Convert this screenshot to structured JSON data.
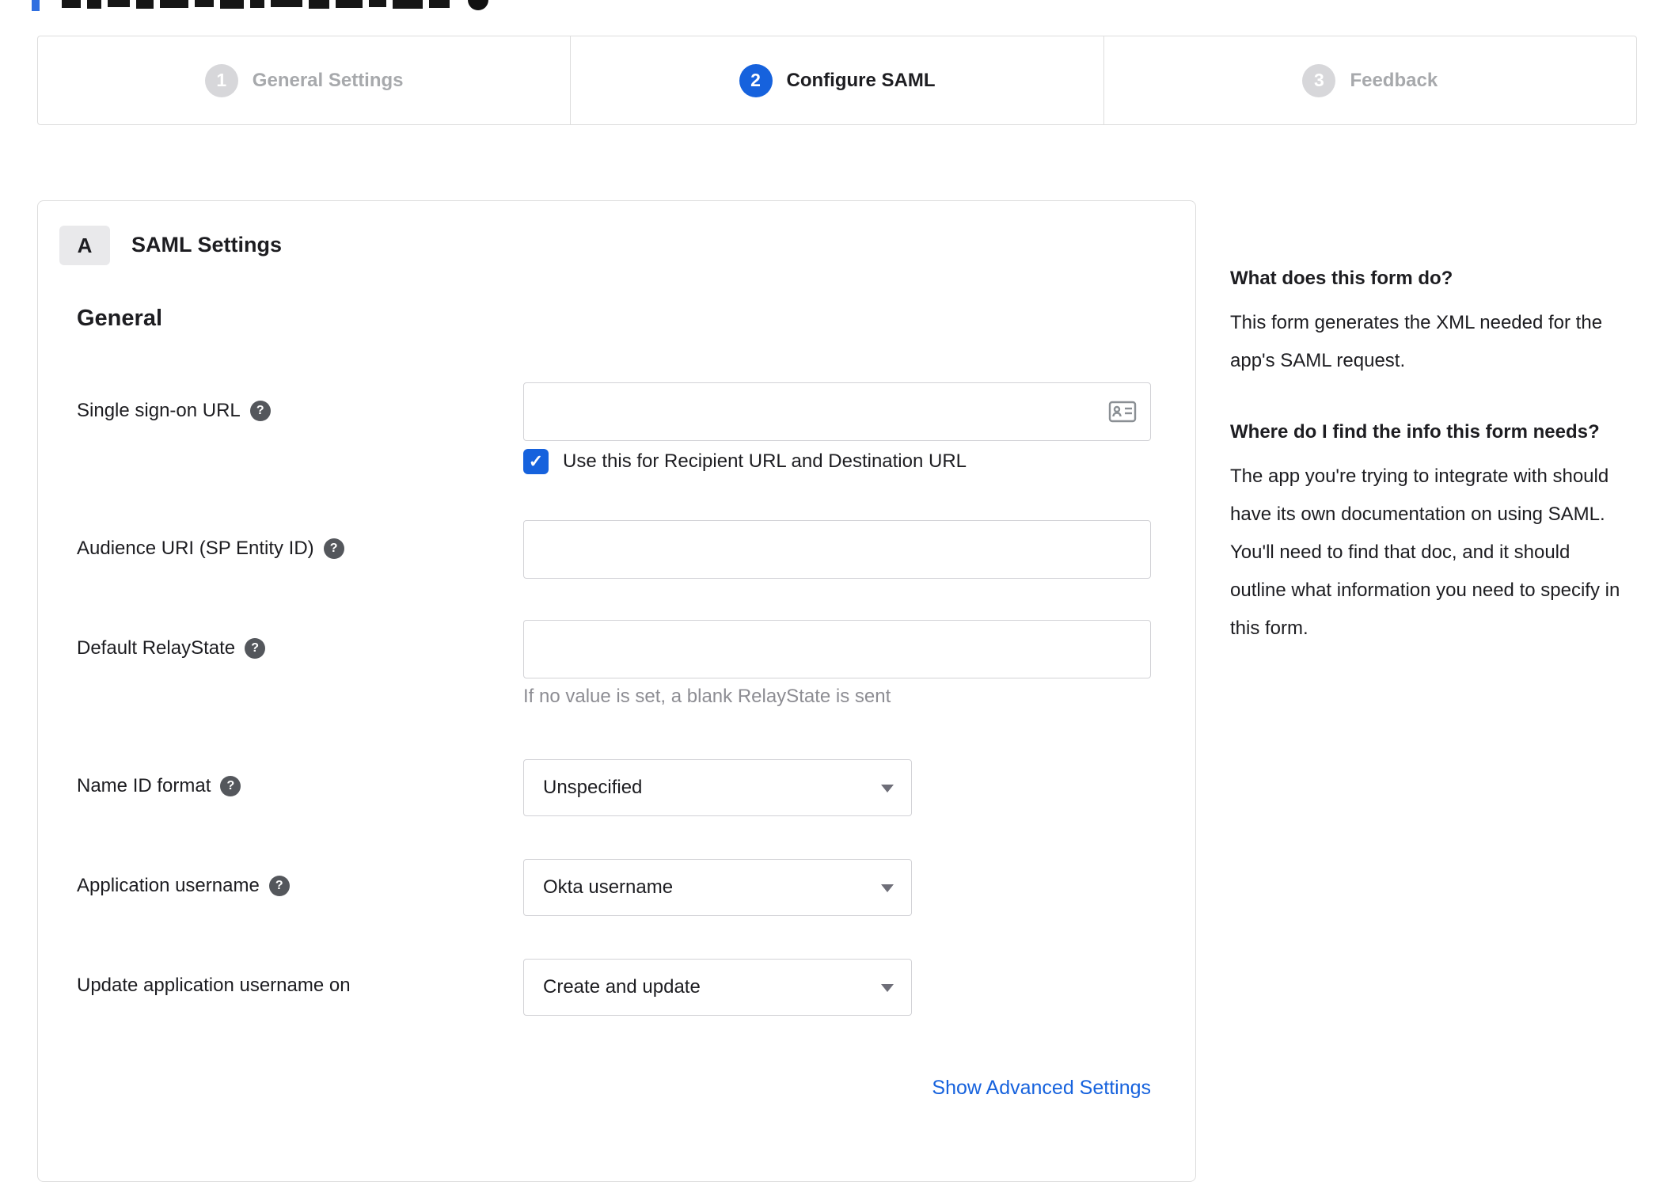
{
  "stepper": {
    "steps": [
      {
        "number": "1",
        "label": "General Settings",
        "state": "inactive"
      },
      {
        "number": "2",
        "label": "Configure SAML",
        "state": "active"
      },
      {
        "number": "3",
        "label": "Feedback",
        "state": "inactive"
      }
    ]
  },
  "panel": {
    "badge": "A",
    "title": "SAML Settings",
    "section_heading": "General",
    "fields": {
      "sso_url": {
        "label": "Single sign-on URL",
        "value": ""
      },
      "sso_checkbox": {
        "label": "Use this for Recipient URL and Destination URL",
        "checked": true
      },
      "audience_uri": {
        "label": "Audience URI (SP Entity ID)",
        "value": ""
      },
      "default_relaystate": {
        "label": "Default RelayState",
        "value": "",
        "helper": "If no value is set, a blank RelayState is sent"
      },
      "name_id_format": {
        "label": "Name ID format",
        "value": "Unspecified"
      },
      "application_username": {
        "label": "Application username",
        "value": "Okta username"
      },
      "update_app_username": {
        "label": "Update application username on",
        "value": "Create and update"
      }
    },
    "advanced_link": "Show Advanced Settings"
  },
  "sidebar": {
    "section1": {
      "heading": "What does this form do?",
      "body": "This form generates the XML needed for the app's SAML request."
    },
    "section2": {
      "heading": "Where do I find the info this form needs?",
      "body": "The app you're trying to integrate with should have its own documentation on using SAML. You'll need to find that doc, and it should outline what information you need to specify in this form."
    }
  },
  "icons": {
    "help_glyph": "?",
    "check_glyph": "✓"
  },
  "colors": {
    "accent": "#1662dd",
    "link": "#1662dd",
    "inactive_step": "#d7d7da",
    "border": "#dddddd",
    "helper_text": "#8d8d93"
  }
}
